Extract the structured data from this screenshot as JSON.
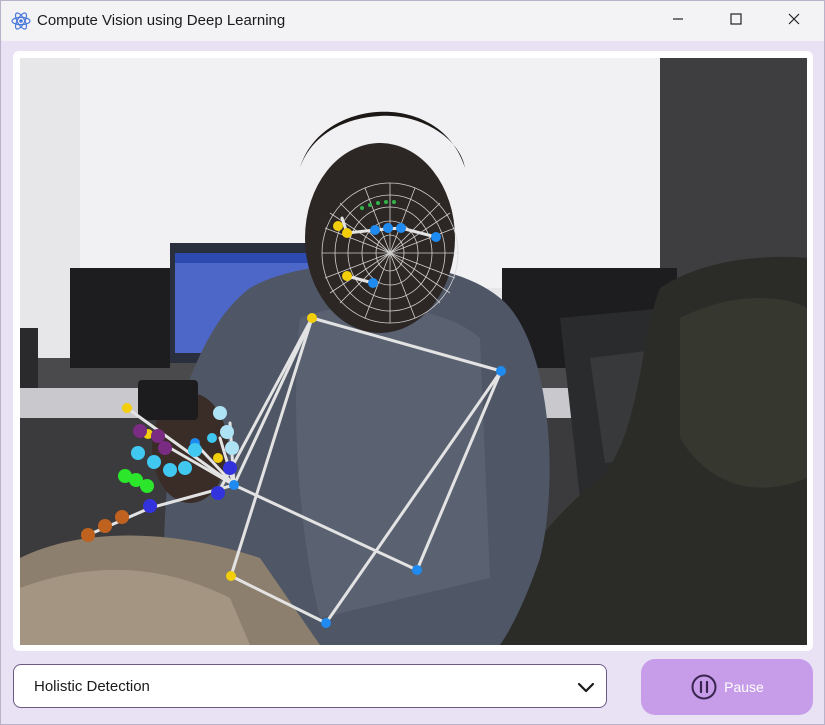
{
  "window": {
    "title": "Compute Vision using Deep Learning",
    "icon": "react-atom-icon",
    "controls": [
      "minimize-icon",
      "maximize-icon",
      "close-icon"
    ]
  },
  "video_feed": {
    "overlays": [
      "face-mesh",
      "pose-skeleton",
      "left-hand-landmarks"
    ]
  },
  "controls": {
    "mode_select": {
      "value": "Holistic Detection",
      "icon": "chevron-down-icon"
    },
    "pause_button": {
      "label": "Pause",
      "icon": "pause-circle-icon"
    }
  },
  "colors": {
    "window_bg": "#e9e2f5",
    "button_bg": "#c79de9",
    "select_border": "#6a5a85",
    "pose_line": "#e6e6e6",
    "landmark_yellow": "#f2cf0a",
    "landmark_blue": "#1f8bf0"
  }
}
